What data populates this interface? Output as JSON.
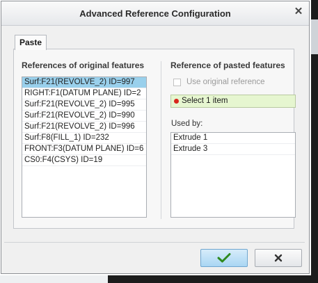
{
  "window": {
    "title": "Advanced Reference Configuration"
  },
  "tabs": [
    {
      "label": "Paste"
    }
  ],
  "left": {
    "heading": "References of original features",
    "items": [
      {
        "label": "Surf:F21(REVOLVE_2) ID=997",
        "selected": true
      },
      {
        "label": "RIGHT:F1(DATUM PLANE) ID=2"
      },
      {
        "label": "Surf:F21(REVOLVE_2) ID=995"
      },
      {
        "label": "Surf:F21(REVOLVE_2) ID=990"
      },
      {
        "label": "Surf:F21(REVOLVE_2) ID=996"
      },
      {
        "label": "Surf:F8(FILL_1) ID=232"
      },
      {
        "label": "FRONT:F3(DATUM PLANE) ID=6"
      },
      {
        "label": "CS0:F4(CSYS) ID=19"
      }
    ]
  },
  "right": {
    "heading": "Reference of pasted features",
    "use_original_label": "Use original reference",
    "use_original_checked": false,
    "collector_label": "Select 1 item",
    "used_by_label": "Used by:",
    "used_by_items": [
      {
        "label": "Extrude 1"
      },
      {
        "label": "Extrude 3"
      }
    ]
  },
  "buttons": {
    "ok_icon": "checkmark-icon",
    "cancel_icon": "x-icon"
  },
  "colors": {
    "selection": "#99d0ec",
    "collector_bg": "#e6f6d0",
    "status_dot": "#d8261c",
    "ok_button": "#a9d6f3"
  }
}
